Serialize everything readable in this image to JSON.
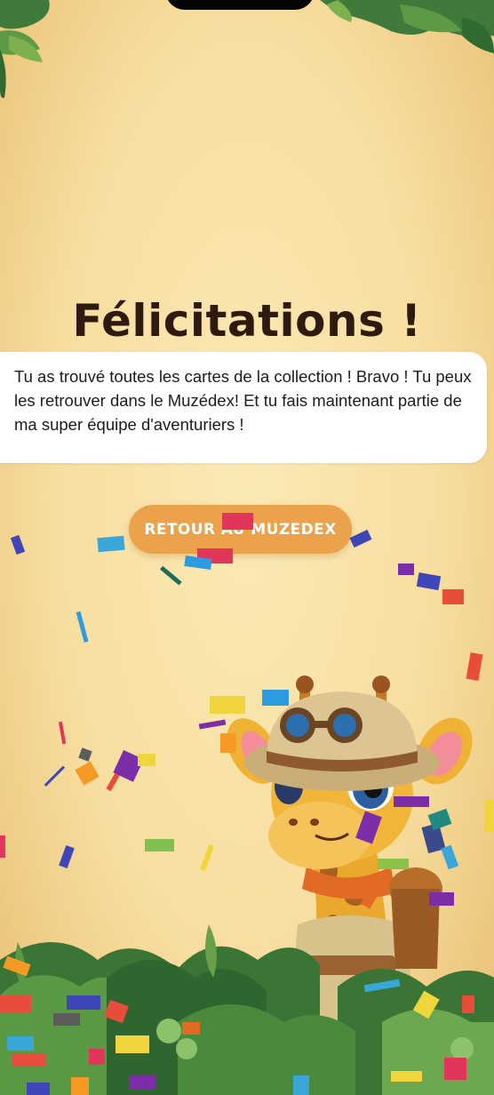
{
  "screen": {
    "title": "Félicitations !",
    "message": "Tu as trouvé toutes les cartes de la collection ! Bravo ! Tu peux les retrouver dans le Muzédex! Et tu fais maintenant partie de ma super équipe d'aventuriers !",
    "button_label": "RETOUR AU MUZEDEX"
  },
  "illustration": {
    "mascot": "giraffe-explorer",
    "foliage": "jungle-leaves",
    "effect": "confetti"
  },
  "colors": {
    "background": "#f7dea0",
    "title": "#2e1a0e",
    "button": "#eba24a",
    "card": "#ffffff"
  }
}
